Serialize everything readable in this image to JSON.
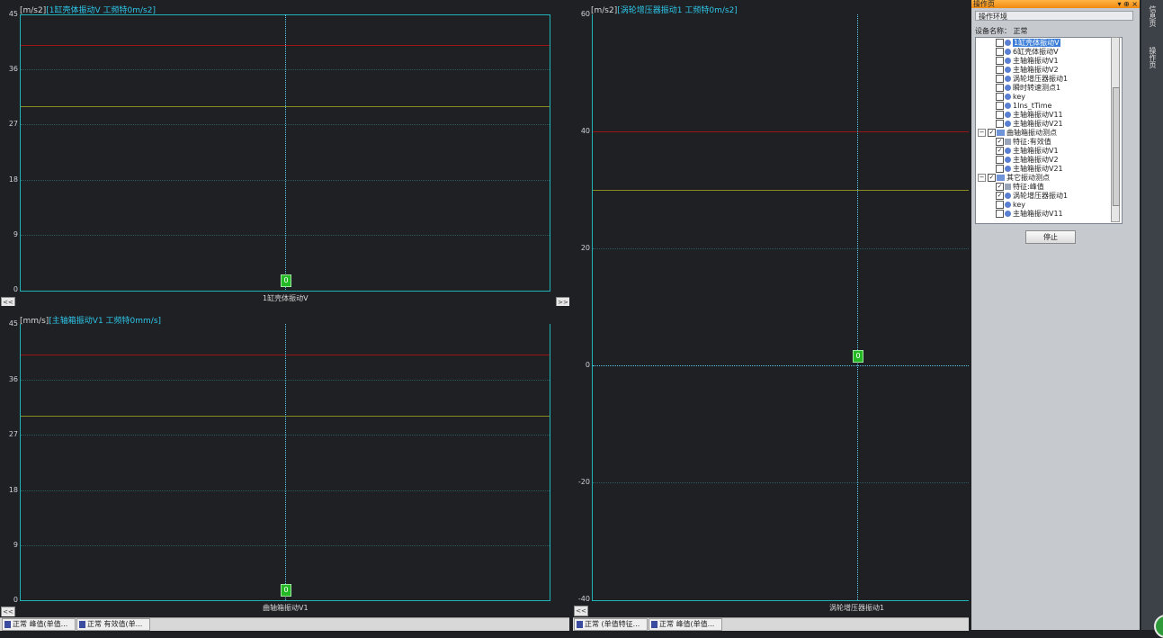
{
  "charts": [
    {
      "unit": "[m/s2]",
      "channel_title": "[1缸壳体振动V 工频特0m/s2]",
      "y_ticks": [
        "45",
        "36",
        "27",
        "18",
        "9",
        "0"
      ],
      "x_label": "1缸壳体振动V",
      "marker": "0"
    },
    {
      "unit": "[mm/s]",
      "channel_title": "[主轴箱振动V1 工频特0mm/s]",
      "y_ticks": [
        "45",
        "36",
        "27",
        "18",
        "9",
        "0"
      ],
      "x_label": "曲轴箱振动V1",
      "marker": "0"
    },
    {
      "unit": "[m/s2]",
      "channel_title": "[涡轮增压器振动1 工频特0m/s2]",
      "y_ticks": [
        "60",
        "40",
        "20",
        "0",
        "-20",
        "-40"
      ],
      "x_label": "涡轮增压器振动1",
      "marker": "0"
    }
  ],
  "nav": {
    "prev": "<<",
    "next": ">>"
  },
  "chart_data": [
    {
      "type": "line",
      "title": "[1缸壳体振动V 工频特0m/s2]",
      "ylabel": "[m/s2]",
      "xlabel": "1缸壳体振动V",
      "ylim": [
        0,
        45
      ],
      "alarm_high": 40,
      "alarm_warn": 30,
      "cursor_value": 0,
      "series": []
    },
    {
      "type": "line",
      "title": "[主轴箱振动V1 工频特0mm/s]",
      "ylabel": "[mm/s]",
      "xlabel": "曲轴箱振动V1",
      "ylim": [
        0,
        45
      ],
      "alarm_high": 40,
      "alarm_warn": 30,
      "cursor_value": 0,
      "series": []
    },
    {
      "type": "line",
      "title": "[涡轮增压器振动1 工频特0m/s2]",
      "ylabel": "[m/s2]",
      "xlabel": "涡轮增压器振动1",
      "ylim": [
        -40,
        60
      ],
      "alarm_high": 40,
      "alarm_warn": 30,
      "cursor_value": 0,
      "series": []
    }
  ],
  "taskbar": [
    "正常 峰值(单值...",
    "正常 有效值(单...",
    "正常 (单值特征...",
    "正常 峰值(单值..."
  ],
  "sidebar": {
    "header": "操作页",
    "controls": "▾ ⊕ ×",
    "tab": "操作环境",
    "device_label": "设备名称：  正常",
    "stop_button": "停止",
    "vertical_tabs": [
      "信息页",
      "操作页"
    ],
    "tree": [
      {
        "indent": 1,
        "type": "item",
        "checked": false,
        "label": "1缸壳体振动V",
        "selected": true
      },
      {
        "indent": 1,
        "type": "item",
        "checked": false,
        "label": "6缸壳体振动V"
      },
      {
        "indent": 1,
        "type": "item",
        "checked": false,
        "label": "主轴箱振动V1"
      },
      {
        "indent": 1,
        "type": "item",
        "checked": false,
        "label": "主轴箱振动V2"
      },
      {
        "indent": 1,
        "type": "item",
        "checked": false,
        "label": "涡轮增压器振动1"
      },
      {
        "indent": 1,
        "type": "item",
        "checked": false,
        "label": "瞬时转速测点1"
      },
      {
        "indent": 1,
        "type": "item",
        "checked": false,
        "label": "key"
      },
      {
        "indent": 1,
        "type": "item",
        "checked": false,
        "label": "1Ins_tTime"
      },
      {
        "indent": 1,
        "type": "item",
        "checked": false,
        "label": "主轴箱振动V11"
      },
      {
        "indent": 1,
        "type": "item",
        "checked": false,
        "label": "主轴箱振动V21"
      },
      {
        "indent": 0,
        "type": "folder",
        "checked": true,
        "label": "曲轴箱振动测点"
      },
      {
        "indent": 1,
        "type": "feature",
        "checked": true,
        "label": "特征:有效值"
      },
      {
        "indent": 1,
        "type": "item",
        "checked": true,
        "label": "主轴箱振动V1"
      },
      {
        "indent": 1,
        "type": "item",
        "checked": false,
        "label": "主轴箱振动V2"
      },
      {
        "indent": 1,
        "type": "item",
        "checked": false,
        "label": "主轴箱振动V21"
      },
      {
        "indent": 0,
        "type": "folder",
        "checked": true,
        "label": "其它振动测点"
      },
      {
        "indent": 1,
        "type": "feature",
        "checked": true,
        "label": "特征:峰值"
      },
      {
        "indent": 1,
        "type": "item",
        "checked": true,
        "label": "涡轮增压器振动1"
      },
      {
        "indent": 1,
        "type": "item",
        "checked": false,
        "label": "key"
      },
      {
        "indent": 1,
        "type": "item",
        "checked": false,
        "label": "主轴箱振动V11"
      }
    ]
  }
}
